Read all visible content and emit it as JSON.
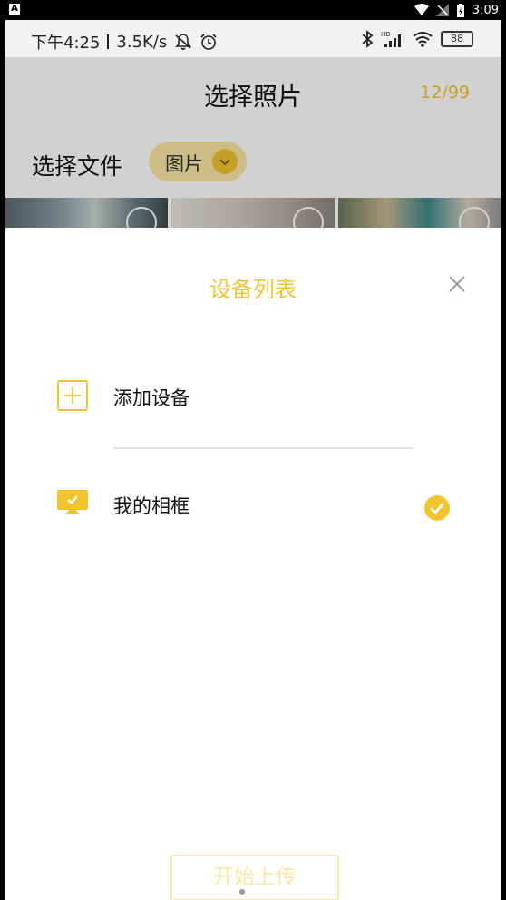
{
  "outer_status": {
    "badge": "A",
    "time": "3:09"
  },
  "inner_status": {
    "time": "下午4:25",
    "speed": "3.5K/s",
    "battery": "88",
    "network_badge": "HD"
  },
  "page": {
    "title": "选择照片",
    "counter": "12/99",
    "file_label": "选择文件",
    "file_chip": "图片"
  },
  "sheet": {
    "title": "设备列表",
    "items": [
      {
        "label": "添加设备",
        "icon": "add-square-icon"
      },
      {
        "label": "我的相框",
        "icon": "frame-monitor-icon",
        "selected": true
      }
    ],
    "start_button": "开始上传"
  },
  "colors": {
    "accent": "#f2c530",
    "accent_light": "#fbe7a4"
  }
}
